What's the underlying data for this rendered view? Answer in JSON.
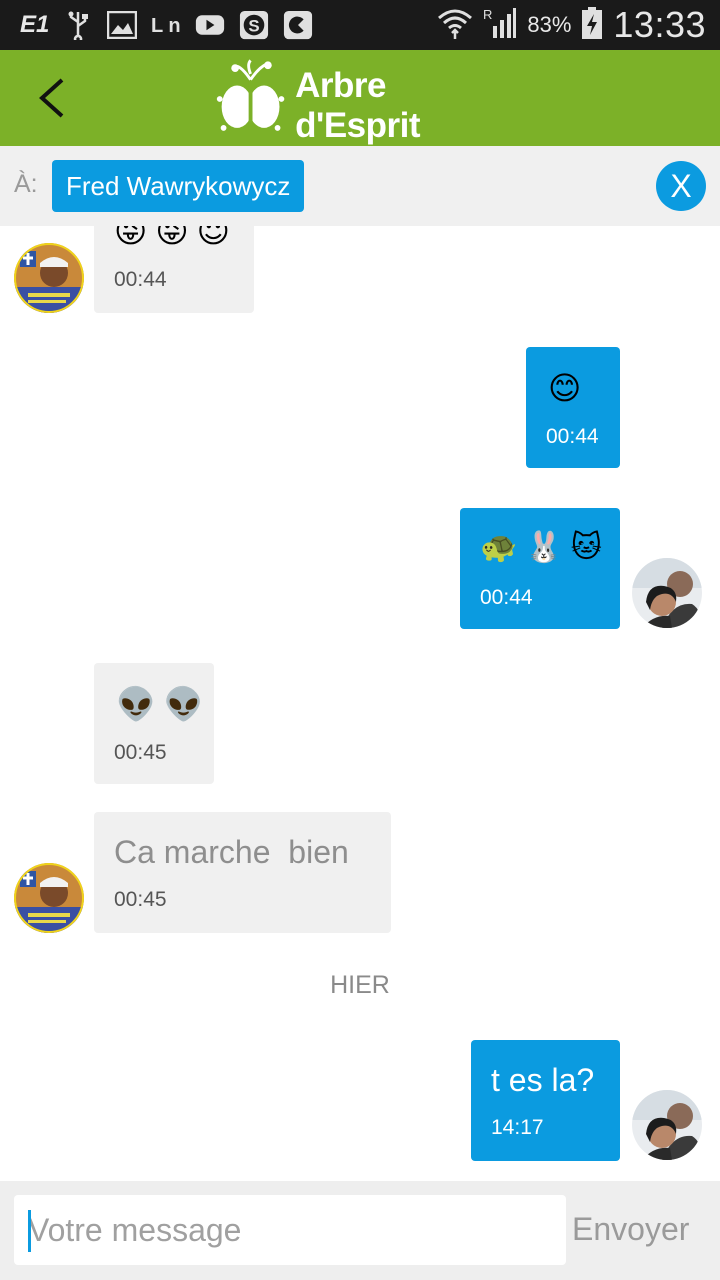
{
  "status_bar": {
    "network_type": "E1",
    "battery": "83%",
    "time": "13:33",
    "icons": [
      "usb-icon",
      "gallery-icon",
      "linkedin-icon",
      "youtube-icon",
      "shazam-icon",
      "app-icon",
      "wifi-icon",
      "signal-icon",
      "battery-icon"
    ]
  },
  "app_bar": {
    "brand": "Arbre d'Esprit",
    "accent": "#7cb128"
  },
  "recipient": {
    "label": "À:",
    "name": "Fred Wawrykowycz",
    "close_label": "X",
    "chip_color": "#0b9be0"
  },
  "messages": [
    {
      "direction": "in",
      "emoji": [
        "😜",
        "😜",
        "😇"
      ],
      "time": "00:44"
    },
    {
      "direction": "out",
      "emoji": [
        "😊"
      ],
      "time": "00:44"
    },
    {
      "direction": "out",
      "emoji": [
        "🐢",
        "🐰",
        "🐱"
      ],
      "time": "00:44"
    },
    {
      "direction": "in",
      "emoji": [
        "👽",
        "👽"
      ],
      "time": "00:45"
    },
    {
      "direction": "in",
      "text": "Ca marche  bien",
      "time": "00:45"
    },
    {
      "direction": "out",
      "text": "t es la?",
      "time": "14:17"
    }
  ],
  "day_separator": "HIER",
  "composer": {
    "placeholder": "Votre message",
    "send_label": "Envoyer"
  }
}
